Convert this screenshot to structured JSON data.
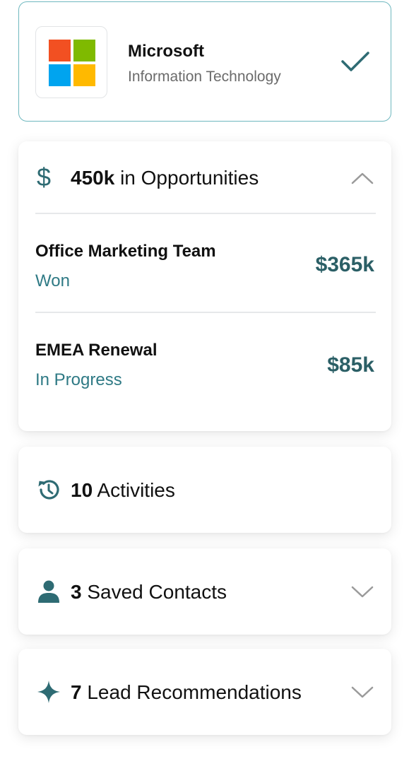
{
  "company": {
    "name": "Microsoft",
    "industry": "Information Technology",
    "logo_colors": [
      "#f25022",
      "#7fba00",
      "#00a4ef",
      "#ffb900"
    ],
    "icons": {
      "logo": "microsoft-logo",
      "status": "check-icon"
    }
  },
  "opportunities": {
    "total": "450k",
    "label": "in Opportunities",
    "icons": {
      "lead": "dollar-icon",
      "toggle": "chevron-up-icon"
    },
    "items": [
      {
        "name": "Office Marketing Team",
        "status": "Won",
        "amount": "$365k"
      },
      {
        "name": "EMEA Renewal",
        "status": "In Progress",
        "amount": "$85k"
      }
    ]
  },
  "activities": {
    "count": "10",
    "label": "Activities",
    "icon": "history-icon"
  },
  "contacts": {
    "count": "3",
    "label": "Saved Contacts",
    "icon": "person-icon",
    "toggle_icon": "chevron-down-icon"
  },
  "leads": {
    "count": "7",
    "label": "Lead Recommendations",
    "icon": "sparkle-icon",
    "toggle_icon": "chevron-down-icon"
  },
  "colors": {
    "accent": "#2e6b73",
    "status": "#2f7a85",
    "card_border": "#6fb8bf",
    "muted": "#6b6b6b"
  }
}
